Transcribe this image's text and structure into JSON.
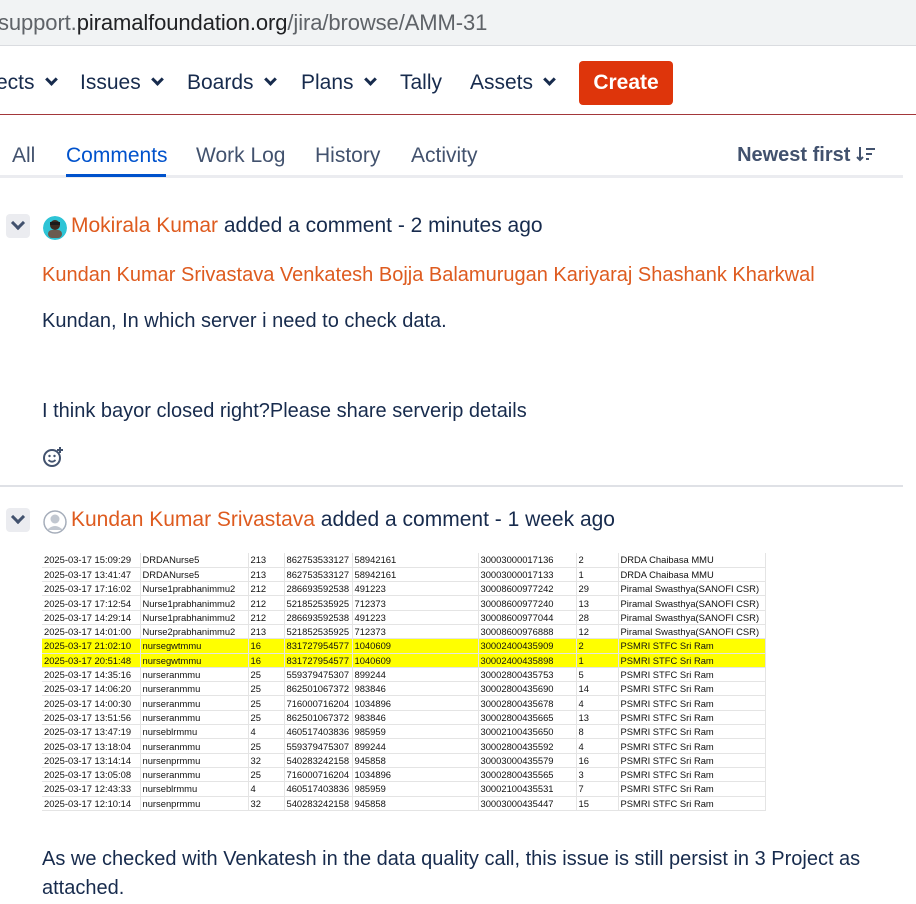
{
  "browser": {
    "url_prefix": "support.",
    "url_domain": "piramalfoundation.org",
    "url_path": "/jira/browse/AMM-31"
  },
  "nav": {
    "items": [
      {
        "label": "ects"
      },
      {
        "label": "Issues"
      },
      {
        "label": "Boards"
      },
      {
        "label": "Plans"
      },
      {
        "label": "Tally"
      },
      {
        "label": "Assets"
      }
    ],
    "create_label": "Create",
    "accent": "#de350b"
  },
  "tabs": {
    "items": [
      "All",
      "Comments",
      "Work Log",
      "History",
      "Activity"
    ],
    "active": "Comments",
    "sort_label": "Newest first"
  },
  "comments": [
    {
      "author": "Mokirala Kumar",
      "action": " added a comment - ",
      "time": "2 minutes ago",
      "mentions": "Kundan Kumar Srivastava Venkatesh Bojja Balamurugan Kariyaraj Shashank Kharkwal",
      "lines": [
        "Kundan, In which server i need to check data.",
        "I think bayor closed right?Please share serverip details"
      ]
    },
    {
      "author": "Kundan Kumar Srivastava",
      "action": " added a comment - ",
      "time": "1 week ago",
      "text": "As we checked with Venkatesh in the data quality call, this issue is still persist in 3 Project as attached."
    }
  ],
  "attachment_rows": [
    [
      "2025-03-17 15:09:29",
      "DRDANurse5",
      "213",
      "862753533127",
      "58942161",
      "30003000017136",
      "2",
      "DRDA Chaibasa MMU"
    ],
    [
      "2025-03-17 13:41:47",
      "DRDANurse5",
      "213",
      "862753533127",
      "58942161",
      "30003000017133",
      "1",
      "DRDA Chaibasa MMU"
    ],
    [
      "2025-03-17 17:16:02",
      "Nurse1prabhanimmu2",
      "212",
      "286693592538",
      "491223",
      "30008600977242",
      "29",
      "Piramal Swasthya(SANOFI CSR)"
    ],
    [
      "2025-03-17 17:12:54",
      "Nurse1prabhanimmu2",
      "212",
      "521852535925",
      "712373",
      "30008600977240",
      "13",
      "Piramal Swasthya(SANOFI CSR)"
    ],
    [
      "2025-03-17 14:29:14",
      "Nurse1prabhanimmu2",
      "212",
      "286693592538",
      "491223",
      "30008600977044",
      "28",
      "Piramal Swasthya(SANOFI CSR)"
    ],
    [
      "2025-03-17 14:01:00",
      "Nurse2prabhanimmu2",
      "213",
      "521852535925",
      "712373",
      "30008600976888",
      "12",
      "Piramal Swasthya(SANOFI CSR)"
    ],
    [
      "2025-03-17 21:02:10",
      "nursegwtmmu",
      "16",
      "831727954577",
      "1040609",
      "30002400435909",
      "2",
      "PSMRI STFC Sri Ram"
    ],
    [
      "2025-03-17 20:51:48",
      "nursegwtmmu",
      "16",
      "831727954577",
      "1040609",
      "30002400435898",
      "1",
      "PSMRI STFC Sri Ram"
    ],
    [
      "2025-03-17 14:35:16",
      "nurseranmmu",
      "25",
      "559379475307",
      "899244",
      "30002800435753",
      "5",
      "PSMRI STFC Sri Ram"
    ],
    [
      "2025-03-17 14:06:20",
      "nurseranmmu",
      "25",
      "862501067372",
      "983846",
      "30002800435690",
      "14",
      "PSMRI STFC Sri Ram"
    ],
    [
      "2025-03-17 14:00:30",
      "nurseranmmu",
      "25",
      "716000716204",
      "1034896",
      "30002800435678",
      "4",
      "PSMRI STFC Sri Ram"
    ],
    [
      "2025-03-17 13:51:56",
      "nurseranmmu",
      "25",
      "862501067372",
      "983846",
      "30002800435665",
      "13",
      "PSMRI STFC Sri Ram"
    ],
    [
      "2025-03-17 13:47:19",
      "nurseblrmmu",
      "4",
      "460517403836",
      "985959",
      "30002100435650",
      "8",
      "PSMRI STFC Sri Ram"
    ],
    [
      "2025-03-17 13:18:04",
      "nurseranmmu",
      "25",
      "559379475307",
      "899244",
      "30002800435592",
      "4",
      "PSMRI STFC Sri Ram"
    ],
    [
      "2025-03-17 13:14:14",
      "nursenprmmu",
      "32",
      "540283242158",
      "945858",
      "30003000435579",
      "16",
      "PSMRI STFC Sri Ram"
    ],
    [
      "2025-03-17 13:05:08",
      "nurseranmmu",
      "25",
      "716000716204",
      "1034896",
      "30002800435565",
      "3",
      "PSMRI STFC Sri Ram"
    ],
    [
      "2025-03-17 12:43:33",
      "nurseblrmmu",
      "4",
      "460517403836",
      "985959",
      "30002100435531",
      "7",
      "PSMRI STFC Sri Ram"
    ],
    [
      "2025-03-17 12:10:14",
      "nursenprmmu",
      "32",
      "540283242158",
      "945858",
      "30003000435447",
      "15",
      "PSMRI STFC Sri Ram"
    ]
  ],
  "highlight_color": "#ffff00"
}
